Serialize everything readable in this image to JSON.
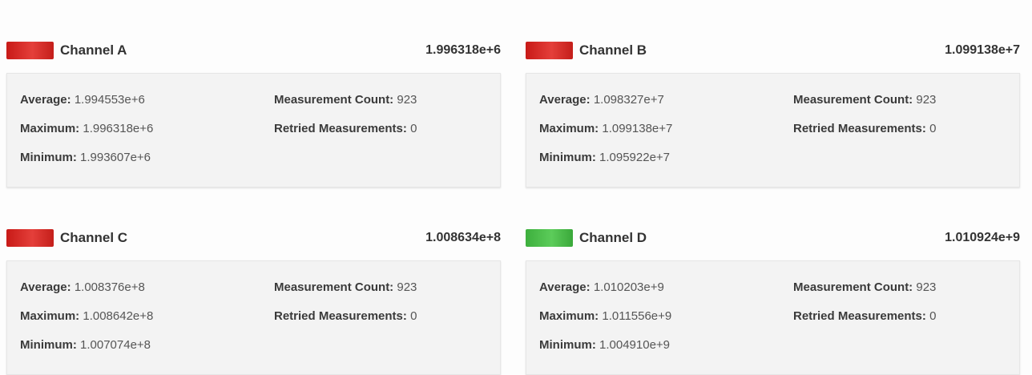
{
  "labels": {
    "average": "Average:",
    "maximum": "Maximum:",
    "minimum": "Minimum:",
    "measurement_count": "Measurement Count:",
    "retried_measurements": "Retried Measurements:"
  },
  "channels": [
    {
      "name": "Channel A",
      "status_color": "#d0271f",
      "value": "1.996318e+6",
      "average": "1.994553e+6",
      "maximum": "1.996318e+6",
      "minimum": "1.993607e+6",
      "measurement_count": "923",
      "retried_measurements": "0"
    },
    {
      "name": "Channel B",
      "status_color": "#d0271f",
      "value": "1.099138e+7",
      "average": "1.098327e+7",
      "maximum": "1.099138e+7",
      "minimum": "1.095922e+7",
      "measurement_count": "923",
      "retried_measurements": "0"
    },
    {
      "name": "Channel C",
      "status_color": "#d0271f",
      "value": "1.008634e+8",
      "average": "1.008376e+8",
      "maximum": "1.008642e+8",
      "minimum": "1.007074e+8",
      "measurement_count": "923",
      "retried_measurements": "0"
    },
    {
      "name": "Channel D",
      "status_color": "#4bbd49",
      "value": "1.010924e+9",
      "average": "1.010203e+9",
      "maximum": "1.011556e+9",
      "minimum": "1.004910e+9",
      "measurement_count": "923",
      "retried_measurements": "0"
    }
  ]
}
